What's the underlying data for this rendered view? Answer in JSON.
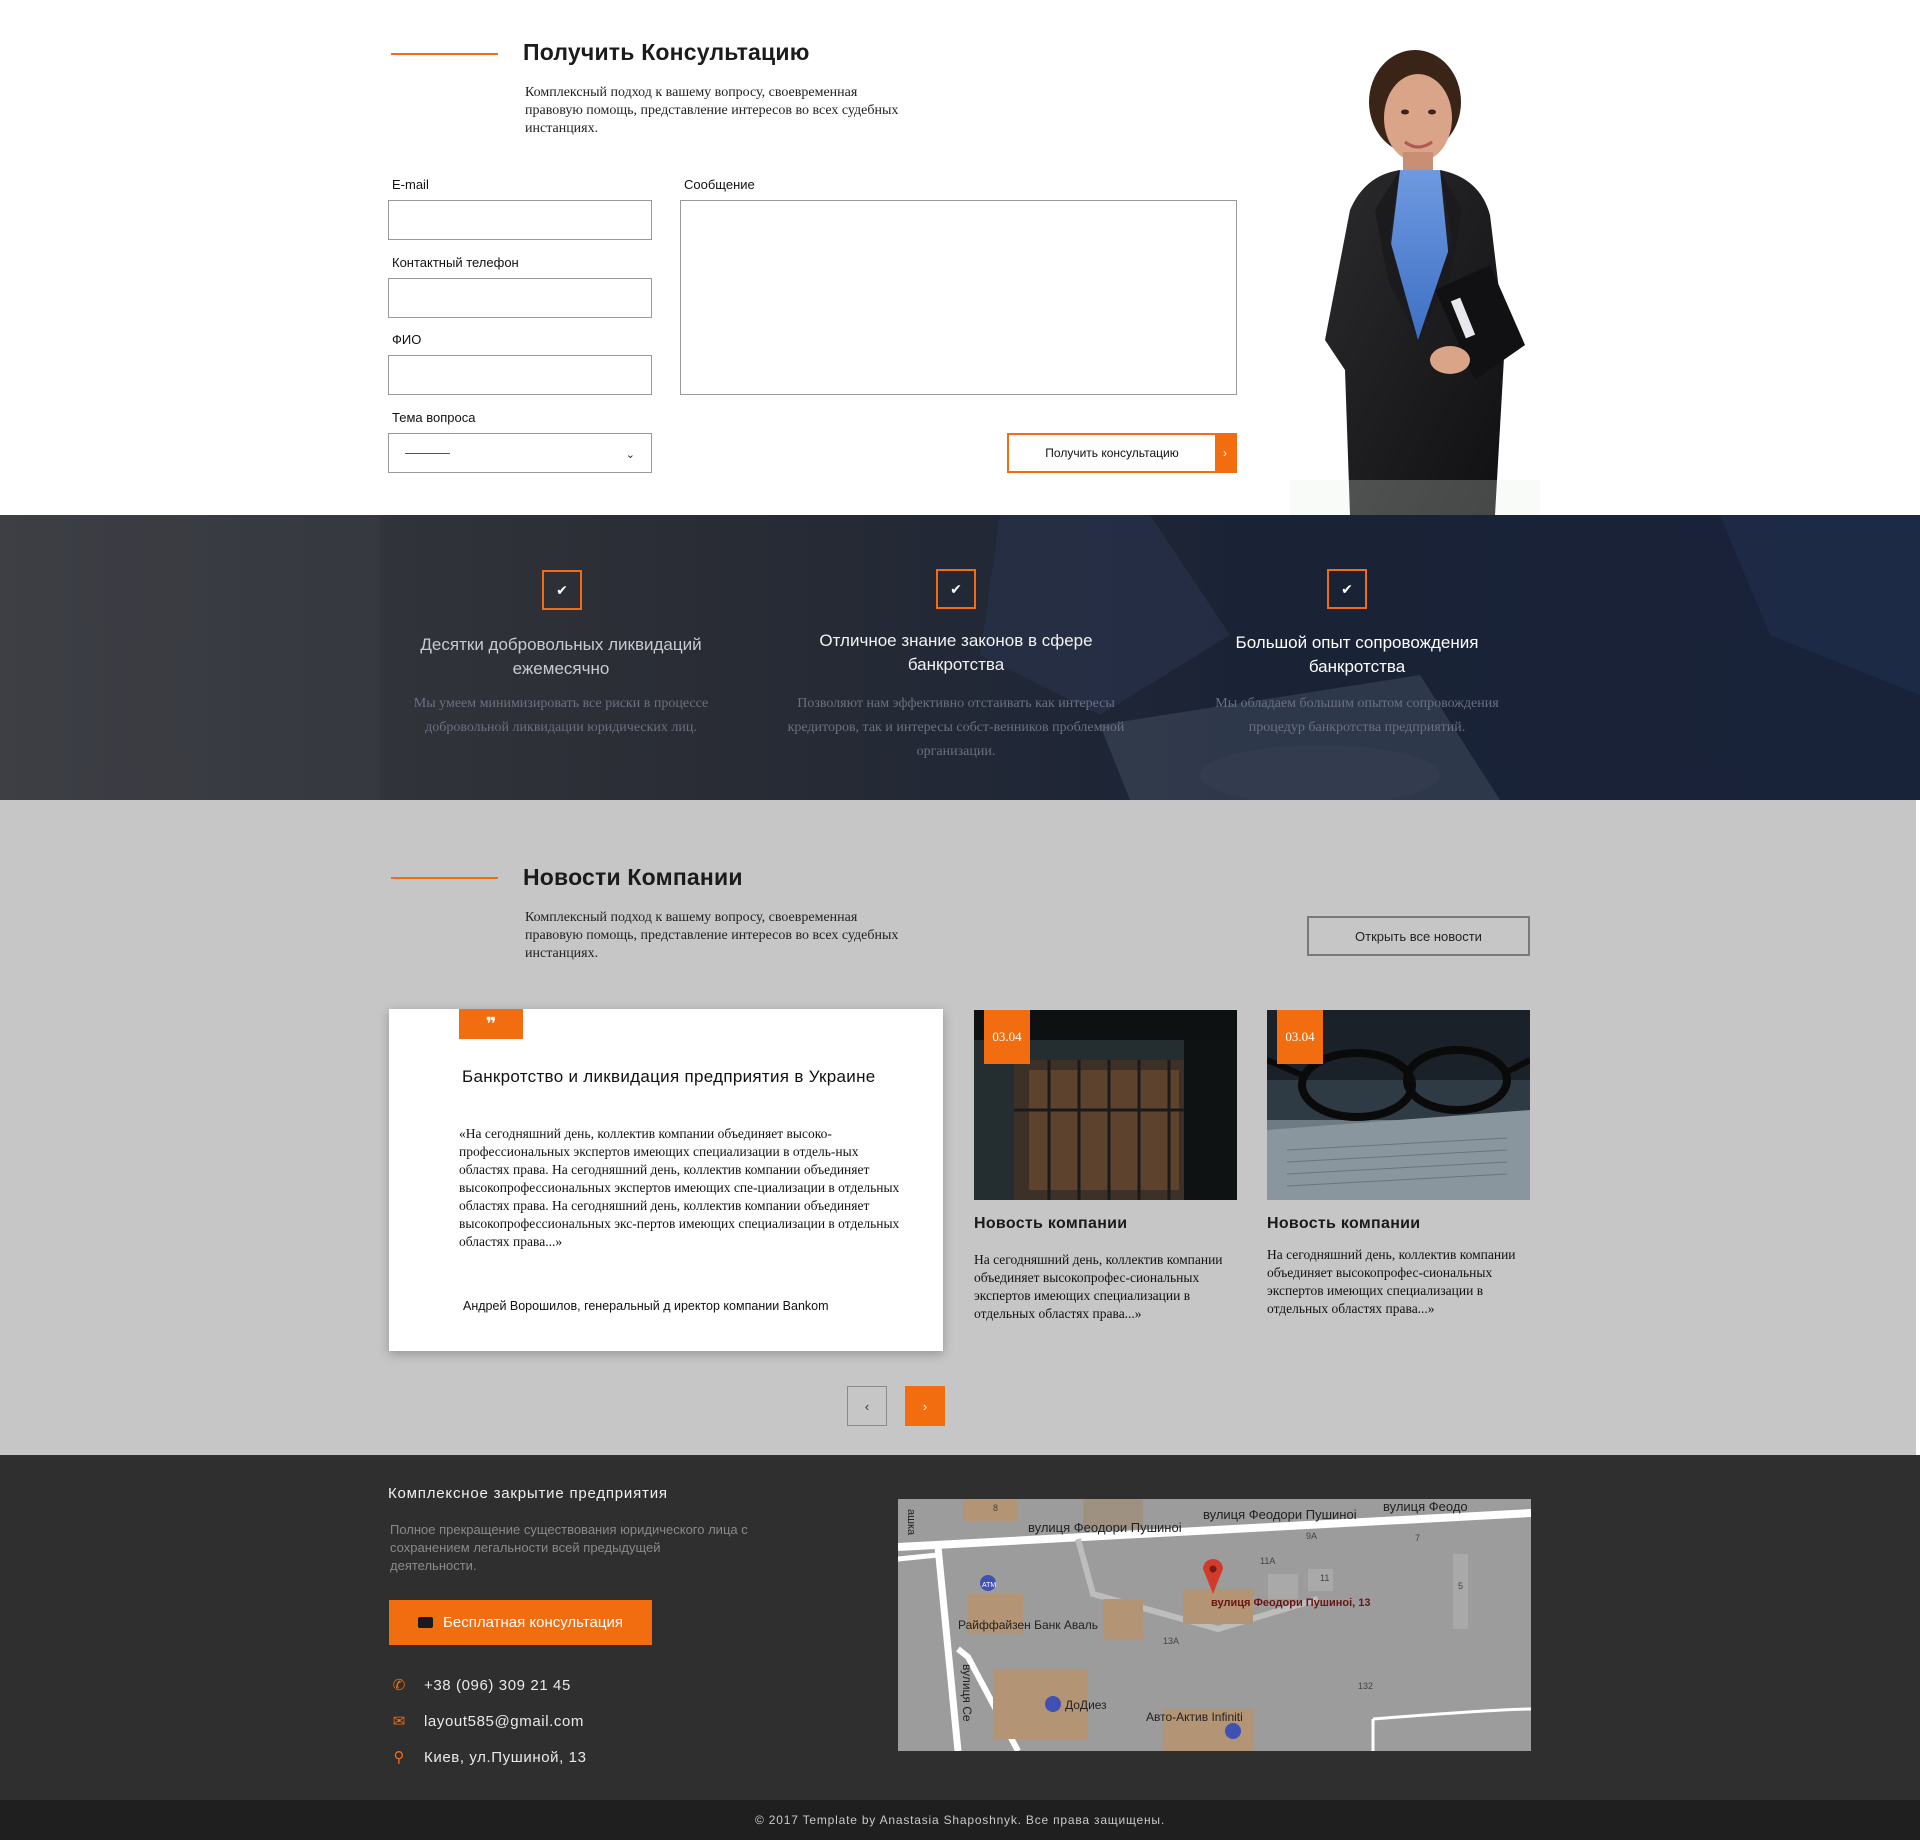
{
  "consult": {
    "title": "Получить Консультацию",
    "description": "Комплексный подход к вашему вопросу, своевременная правовую помощь, представление интересов во всех судебных инстанциях.",
    "email_label": "E-mail",
    "email_value": "",
    "phone_label": "Контактный телефон",
    "phone_value": "",
    "name_label": "ФИО",
    "name_value": "",
    "topic_label": "Тема вопроса",
    "topic_value": "———",
    "message_label": "Сообщение",
    "message_value": "",
    "submit_label": "Получить консультацию"
  },
  "features": [
    {
      "title": "Десятки добровольных ликвидаций ежемесячно",
      "text": "Мы умеем минимизировать все риски в процессе добровольной ликвидации юридических лиц."
    },
    {
      "title": "Отличное знание законов в сфере банкротства",
      "text": "Позволяют нам эффективно отстаивать как интересы кредиторов, так и интересы собст-венников проблемной организации."
    },
    {
      "title": "Большой опыт сопровождения банкротства",
      "text": "Мы обладаем большим опытом сопровождения процедур банкротства предприятий."
    }
  ],
  "news": {
    "title": "Новости Компании",
    "description": "Комплексный подход к вашему вопросу, своевременная правовую помощь, представление интересов во всех судебных инстанциях.",
    "all_news_label": "Открыть все новости",
    "quote": {
      "badge": "❞",
      "title": "Банкротство и ликвидация предприятия в Украине",
      "text": "«На сегодняшний день, коллектив компании объединяет высоко-профессиональных экспертов имеющих специализации в отдель-ных областях права. На сегодняшний день, коллектив компании объединяет высокопрофессиональных экспертов имеющих спе-циализации в отдельных областях права. На сегодняшний день, коллектив компании объединяет высокопрофессиональных экс-пертов имеющих специализации в отдельных областях права...»",
      "author": "Андрей Ворошилов, генеральный д иректор компании Bankom"
    },
    "cards": [
      {
        "date": "03.04",
        "title": "Новость компании",
        "text": "На сегодняшний день, коллектив компании объединяет высокопрофес-сиональных экспертов имеющих специализации в отдельных областях права...»"
      },
      {
        "date": "03.04",
        "title": "Новость компании",
        "text": "На сегодняшний день, коллектив компании объединяет высокопрофес-сиональных экспертов имеющих специализации в отдельных областях права...»"
      }
    ],
    "prev": "‹",
    "next": "›"
  },
  "footer": {
    "title": "Комплексное закрытие предприятия",
    "description": "Полное прекращение существования юридического лица с сохранением легальности всей предыдущей деятельности.",
    "cta_label": "Бесплатная консультация",
    "phone": "+38 (096) 309 21 45",
    "email": "layout585@gmail.com",
    "address": "Киев, ул.Пушиной, 13",
    "map": {
      "street1": "вулиця Феодори Пушиноі",
      "street2": "вулиця Феодори Пушиноі",
      "street3": "вулиця Феодо",
      "street_left": "вулиця Се",
      "street_left2": "ашка",
      "bank": "Райффайзен Банк Аваль",
      "pin_label": "вулиця Феодори Пушиноі, 13",
      "shop1": "ДоДиез",
      "shop2": "Авто-Актив Infiniti",
      "atm": "ATM",
      "n8": "8",
      "n9a": "9A",
      "n7": "7",
      "n11a": "11A",
      "n11": "11",
      "n5": "5",
      "n13a": "13A",
      "n132": "132"
    },
    "copyright": "© 2017 Template by Anastasia Shaposhnyk. Все права защищены."
  },
  "colors": {
    "accent": "#f26d10",
    "dark": "#2f2f2f",
    "news_bg": "#c6c6c6"
  }
}
